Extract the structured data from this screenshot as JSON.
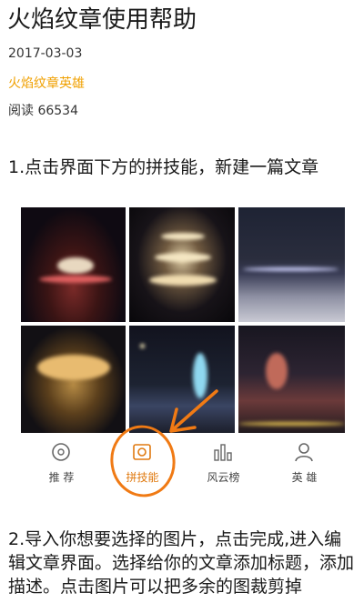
{
  "article": {
    "title": "火焰纹章使用帮助",
    "date": "2017-03-03",
    "author": "火焰纹章英雄",
    "reads": "阅读 66534"
  },
  "steps": [
    "1.点击界面下方的拼技能，新建一篇文章",
    "2.导入你想要选择的图片，点击完成,进入编辑文章界面。选择给你的文章添加标题，添加描述。点击图片可以把多余的图裁剪掉"
  ],
  "screenshot": {
    "tabs": [
      {
        "label": "推 荐",
        "icon": "disc-icon",
        "selected": false
      },
      {
        "label": "拼技能",
        "icon": "camera-square-icon",
        "selected": true
      },
      {
        "label": "风云榜",
        "icon": "bar-chart-icon",
        "selected": false
      },
      {
        "label": "英 雄",
        "icon": "person-icon",
        "selected": false
      }
    ]
  },
  "colors": {
    "author": "#f0a000",
    "annotation": "#f07a14",
    "selected_tab": "#e07a10"
  }
}
